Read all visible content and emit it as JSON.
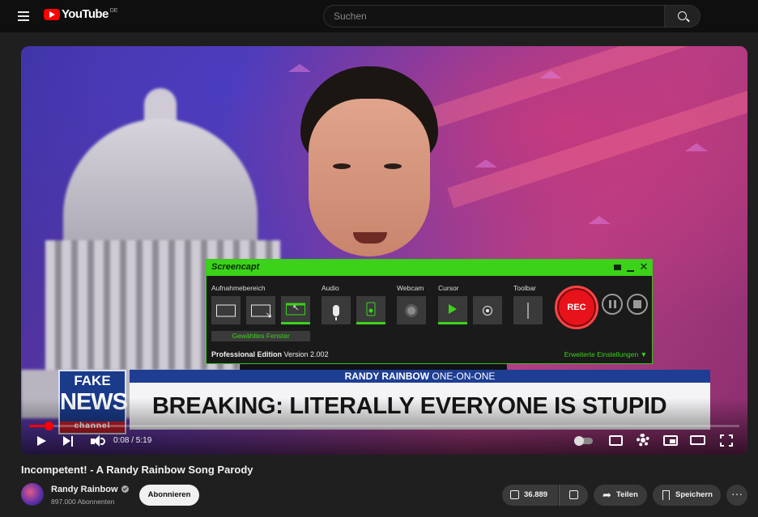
{
  "header": {
    "logo_text": "YouTube",
    "region": "DE",
    "search_placeholder": "Suchen"
  },
  "player": {
    "time_current": "0:08",
    "time_total": "5:19",
    "time_label": "0:08 / 5:19",
    "progress_fraction": 0.027,
    "lower_third": {
      "logo_fake": "FAKE",
      "logo_news": "NEWS",
      "logo_channel": "channel",
      "show_host": "RANDY RAINBOW",
      "show_name": "ONE-ON-ONE",
      "headline": "BREAKING: LITERALLY EVERYONE IS STUPID"
    }
  },
  "screencapt": {
    "title": "Screencapt",
    "sections": {
      "area": "Aufnahmebereich",
      "audio": "Audio",
      "webcam": "Webcam",
      "cursor": "Cursor",
      "toolbar": "Toolbar"
    },
    "selected_area_label": "Gewähltes Fenster",
    "rec_label": "REC",
    "edition": "Professional Edition",
    "version": "Version 2.002",
    "advanced_settings": "Erweiterte Einstellungen ▼",
    "accent_color": "#3cd21a"
  },
  "video": {
    "title": "Incompetent! - A Randy Rainbow Song Parody",
    "channel": "Randy Rainbow",
    "subscribers": "897.000 Abonnenten",
    "subscribe_label": "Abonnieren",
    "likes": "36.889",
    "share_label": "Teilen",
    "save_label": "Speichern",
    "more_label": "···"
  }
}
